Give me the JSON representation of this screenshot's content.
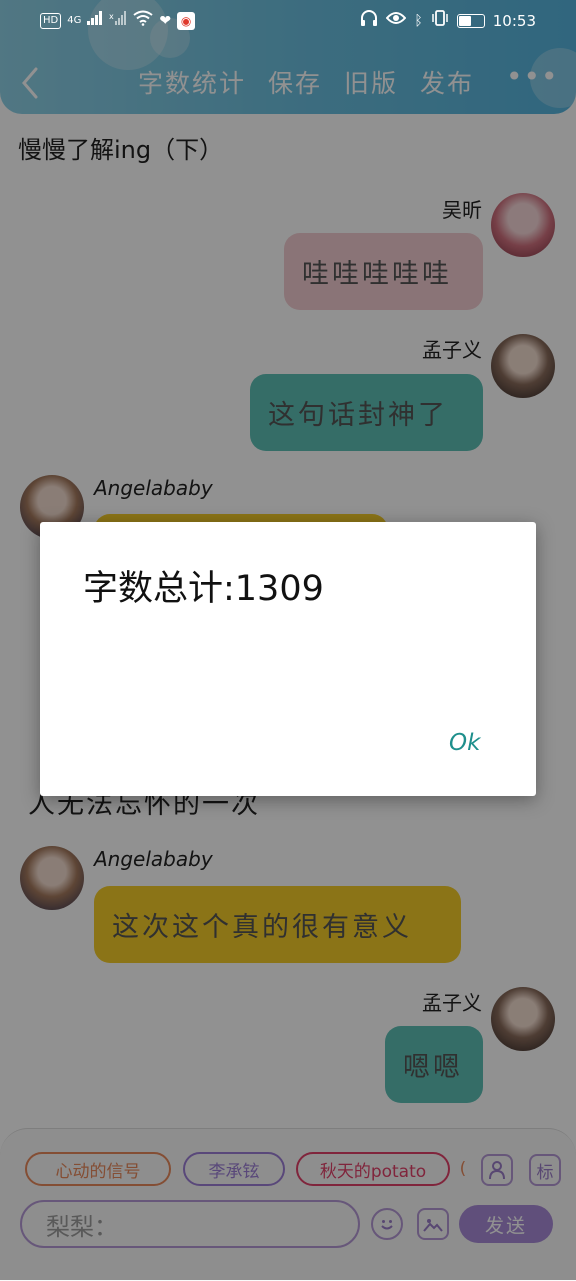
{
  "status_bar": {
    "hd_label": "HD",
    "network_label": "4G",
    "time": "10:53",
    "battery_level": 0.55
  },
  "header": {
    "back_icon": "back-chevron-icon",
    "actions": [
      "字数统计",
      "保存",
      "旧版",
      "发布"
    ],
    "more_icon": "more-dots-icon",
    "gradient": [
      "#8fd1e6",
      "#56b4dd"
    ]
  },
  "chat": {
    "title": "慢慢了解ing（下）",
    "messages": [
      {
        "sender": "吴昕",
        "text": "哇哇哇哇哇",
        "side": "right",
        "bubble_color": "#f3cdd2"
      },
      {
        "sender": "孟子义",
        "text": "这句话封神了",
        "side": "right",
        "bubble_color": "#5ec0b6"
      },
      {
        "sender": "Angelababy",
        "text": "",
        "side": "left",
        "bubble_color": "#f4cd2a"
      },
      {
        "sender": "",
        "text": "人无法忘怀的一次",
        "side": "left",
        "bubble_color": ""
      },
      {
        "sender": "Angelababy",
        "text": "这次这个真的很有意义",
        "side": "left",
        "bubble_color": "#f4cd2a"
      },
      {
        "sender": "孟子义",
        "text": "嗯嗯",
        "side": "right",
        "bubble_color": "#5ec0b6"
      }
    ]
  },
  "bottom": {
    "chips": [
      {
        "label": "心动的信号",
        "color": "#e8895c"
      },
      {
        "label": "李承铉",
        "color": "#9d7fd6"
      },
      {
        "label": "秋天的potato",
        "color": "#e2416a"
      }
    ],
    "person_icon": "person-icon",
    "tag_icon": "tag-icon",
    "tag_label": "标",
    "input_value": "梨梨：",
    "emoji_icon": "emoji-icon",
    "image_icon": "image-icon",
    "send_label": "发送",
    "accent": "#a98cd8"
  },
  "dialog": {
    "message": "字数总计:1309",
    "ok_label": "Ok",
    "ok_color": "#1e8f8c"
  }
}
